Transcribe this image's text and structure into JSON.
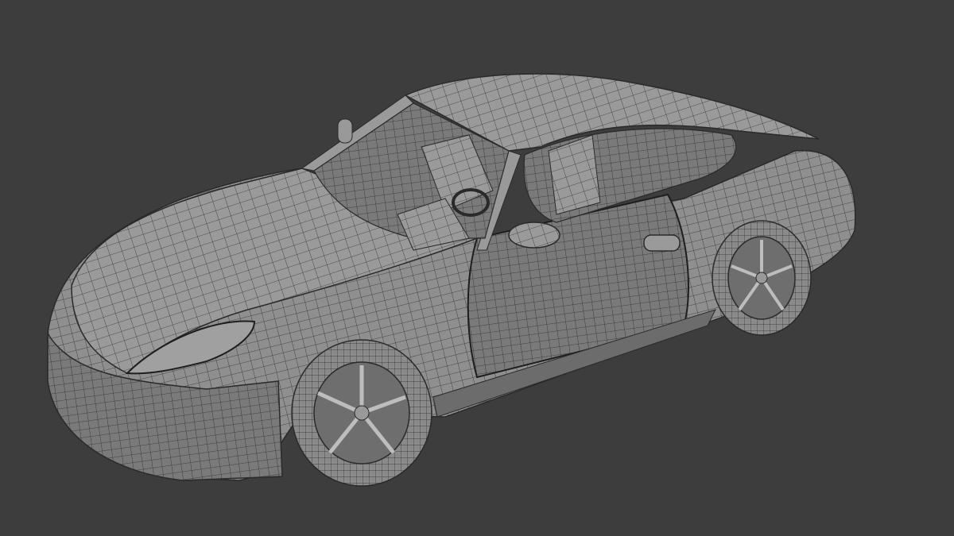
{
  "viewport": {
    "background_color": "#3d3d3d",
    "mesh_color": "#8c8c8c",
    "mesh_shadow_color": "#5e5e5e",
    "wire_color": "#2a2a2a",
    "subject": "car-wireframe-model"
  }
}
